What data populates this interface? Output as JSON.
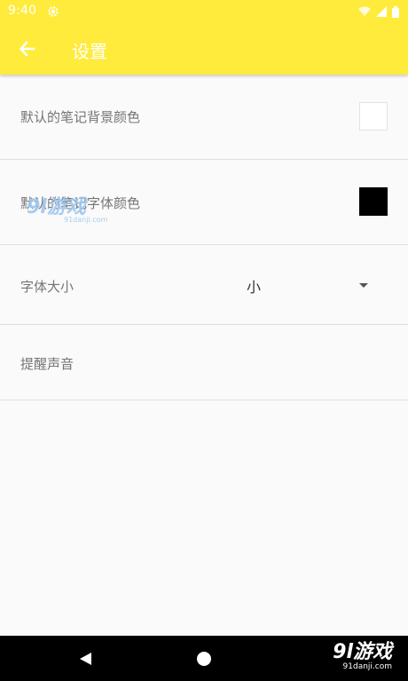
{
  "status": {
    "time": "9:40"
  },
  "appbar": {
    "title": "设置"
  },
  "settings": {
    "bg_color_label": "默认的笔记背景颜色",
    "font_color_label": "默认的笔记字体颜色",
    "font_size_label": "字体大小",
    "font_size_value": "小",
    "sound_label": "提醒声音"
  },
  "swatches": {
    "bg_color": "#ffffff",
    "font_color": "#000000"
  },
  "watermark": {
    "brand": "9l游戏",
    "site": "91danji.com"
  },
  "colors": {
    "toolbar": "#ffeb3b",
    "text_secondary": "#757575"
  }
}
